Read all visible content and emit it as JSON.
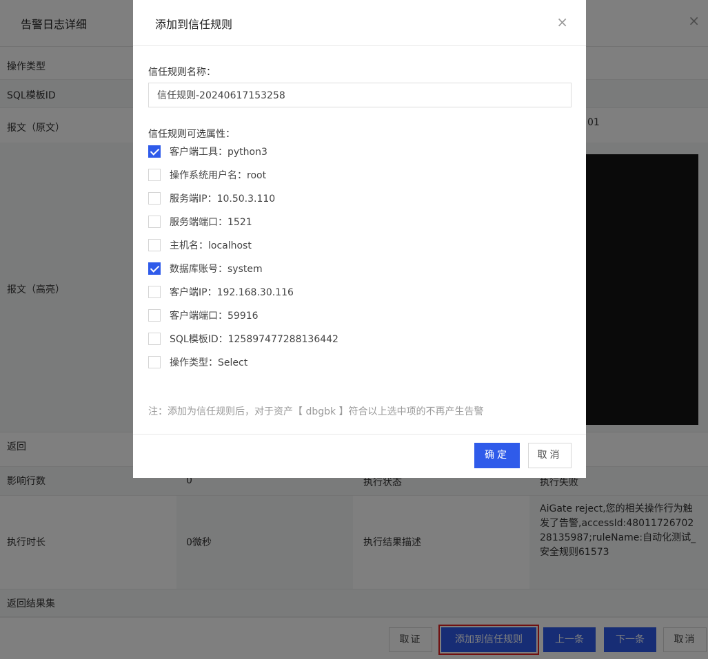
{
  "background": {
    "title": "告警日志详细",
    "close": "×",
    "rows": {
      "op_type": "操作类型",
      "sql_template_id": "SQL模板ID",
      "message_raw": "报文（原文）",
      "message_highlight": "报文（高亮）",
      "return": "返回",
      "affected_rows": "影响行数",
      "affected_rows_value": "0",
      "exec_status_label": "执行状态",
      "exec_status_value": "执行失败",
      "exec_duration": "执行时长",
      "exec_duration_value": "0微秒",
      "exec_result_desc_label": "执行结果描述",
      "exec_result_desc_value": "AiGate reject,您的相关操作行为触发了告警,accessId:4801172670228135987;ruleName:自动化测试_安全规则61573",
      "result_set": "返回结果集",
      "partial_value": "01"
    },
    "footer": {
      "verify": "取证",
      "add_trust_rule": "添加到信任规则",
      "prev": "上一条",
      "next": "下一条",
      "cancel": "取消"
    }
  },
  "modal": {
    "title": "添加到信任规则",
    "close": "×",
    "name_label": "信任规则名称：",
    "name_value": "信任规则-20240617153258",
    "attrs_label": "信任规则可选属性：",
    "options": [
      {
        "label": "客户端工具：python3",
        "checked": true
      },
      {
        "label": "操作系统用户名：root",
        "checked": false
      },
      {
        "label": "服务端IP：10.50.3.110",
        "checked": false
      },
      {
        "label": "服务端端口：1521",
        "checked": false
      },
      {
        "label": "主机名：localhost",
        "checked": false
      },
      {
        "label": "数据库账号：system",
        "checked": true
      },
      {
        "label": "客户端IP：192.168.30.116",
        "checked": false
      },
      {
        "label": "客户端端口：59916",
        "checked": false
      },
      {
        "label": "SQL模板ID：125897477288136442",
        "checked": false
      },
      {
        "label": "操作类型：Select",
        "checked": false
      }
    ],
    "note": "注：添加为信任规则后，对于资产【 dbgbk 】符合以上选中项的不再产生告警",
    "ok": "确定",
    "cancel": "取消"
  },
  "colors": {
    "primary": "#2f5bea",
    "highlight_border": "#e02020"
  }
}
